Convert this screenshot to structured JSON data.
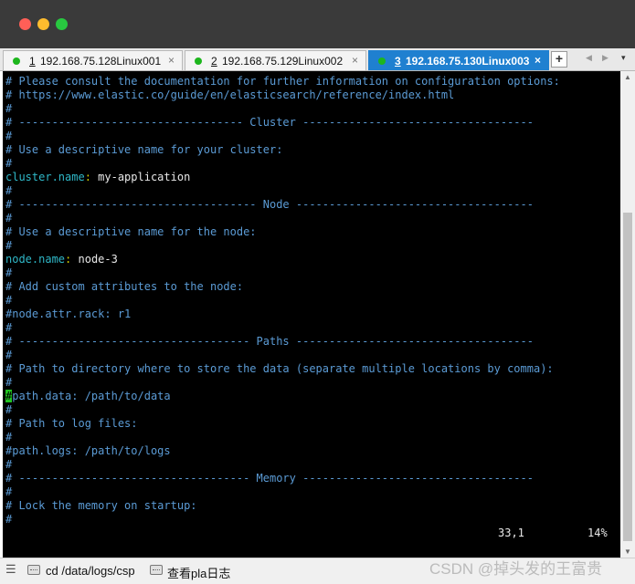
{
  "tabs": [
    {
      "number": "1",
      "host": "192.168.75.128Linux001",
      "close": "×"
    },
    {
      "number": "2",
      "host": "192.168.75.129Linux002",
      "close": "×"
    },
    {
      "number": "3",
      "host": "192.168.75.130Linux003",
      "close": "×"
    }
  ],
  "tab_controls": {
    "add": "+",
    "prev": "◀",
    "next": "▶",
    "menu": "▾"
  },
  "terminal": {
    "lines": [
      "# Please consult the documentation for further information on configuration options:",
      "# https://www.elastic.co/guide/en/elasticsearch/reference/index.html",
      "#",
      "# ---------------------------------- Cluster -----------------------------------",
      "#",
      "# Use a descriptive name for your cluster:",
      "#",
      "#",
      "# ------------------------------------ Node ------------------------------------",
      "#",
      "# Use a descriptive name for the node:",
      "#",
      "#",
      "# Add custom attributes to the node:",
      "#",
      "#node.attr.rack: r1",
      "#",
      "# ----------------------------------- Paths ------------------------------------",
      "#",
      "# Path to directory where to store the data (separate multiple locations by comma):",
      "#",
      "#path.data: /path/to/data",
      "#",
      "# Path to log files:",
      "#",
      "#path.logs: /path/to/logs",
      "#",
      "# ----------------------------------- Memory -----------------------------------",
      "#",
      "# Lock the memory on startup:",
      "#"
    ],
    "setting_cluster": {
      "key": "cluster.name",
      "colon": ":",
      "value": " my-application"
    },
    "setting_node": {
      "key": "node.name",
      "colon": ":",
      "value": " node-3"
    },
    "cursor_char": "#",
    "cursor_rest": "path.data: /path/to/data",
    "position": "33,1",
    "percent": "14%"
  },
  "scrollbar": {
    "up": "▲",
    "down": "▼"
  },
  "bottombar": {
    "menu": "☰",
    "cmd1": "cd /data/logs/csp",
    "cmd2": "查看pla日志"
  },
  "watermark": "CSDN @掉头发的王富贵"
}
